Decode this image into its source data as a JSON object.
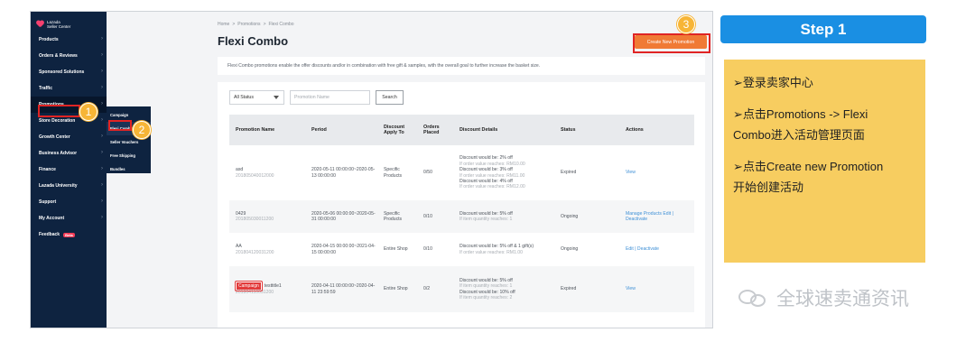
{
  "sidebar": {
    "logo": {
      "line1": "Lazada",
      "line2": "Seller Center"
    },
    "items": [
      {
        "label": "Products",
        "has_chevron": true
      },
      {
        "label": "Orders & Reviews",
        "has_chevron": true
      },
      {
        "label": "Sponsored Solutions",
        "has_chevron": true
      },
      {
        "label": "Traffic",
        "has_chevron": true
      },
      {
        "label": "Promotions",
        "has_chevron": true
      },
      {
        "label": "Store Decoration",
        "has_chevron": true
      },
      {
        "label": "Growth Center",
        "has_chevron": true
      },
      {
        "label": "Business Advisor",
        "has_chevron": true
      },
      {
        "label": "Finance",
        "has_chevron": true
      },
      {
        "label": "Lazada University",
        "has_chevron": true
      },
      {
        "label": "Support",
        "has_chevron": true
      },
      {
        "label": "My Account",
        "has_chevron": true
      },
      {
        "label": "Feedback",
        "badge": "Beta"
      }
    ],
    "submenu": [
      {
        "label": "Campaign"
      },
      {
        "label": "Flexi Combo"
      },
      {
        "label": "Seller Vouchers"
      },
      {
        "label": "Free Shipping"
      },
      {
        "label": "Bundles"
      }
    ]
  },
  "main": {
    "breadcrumb": [
      "Home",
      "Promotions",
      "Flexi Combo"
    ],
    "title": "Flexi Combo",
    "create_button": "Create New Promotion",
    "intro": "Flexi Combo promotions enable the offer discounts and/or in combination with free gift & samples, with the overall goal to further increase the basket size.",
    "filter": {
      "status_value": "All Status",
      "search_placeholder": "Promotion Name",
      "search_button": "Search"
    },
    "columns": [
      "Promotion Name",
      "Period",
      "Discount Apply To",
      "Orders Placed",
      "Discount Details",
      "Status",
      "Actions"
    ],
    "rows": [
      {
        "name": "asd",
        "id": "201805040012000",
        "period": "2020-05-11 00:00:00~2020-05-13 00:00:00",
        "apply_to": "Specific Products",
        "orders": "0/50",
        "details": [
          {
            "main": "Discount would be: 2% off",
            "sub": "If order value reaches: RM10.00"
          },
          {
            "main": "Discount would be: 3% off",
            "sub": "If order value reaches: RM11.00"
          },
          {
            "main": "Discount would be: 4% off",
            "sub": "If order value reaches: RM12.00"
          }
        ],
        "status": "Expired",
        "actions": "View",
        "campaign": ""
      },
      {
        "name": "0429",
        "id": "201805030011200",
        "period": "2020-05-06 00:00:00~2020-05-31 00:00:00",
        "apply_to": "Specific Products",
        "orders": "0/10",
        "details": [
          {
            "main": "Discount would be: 5% off",
            "sub": "If item quantity reaches: 1"
          }
        ],
        "status": "Ongoing",
        "actions": "Manage Products Edit | Deactivate",
        "campaign": ""
      },
      {
        "name": "AA",
        "id": "201804120031200",
        "period": "2020-04-15 00:00:00~2021-04-15 00:00:00",
        "apply_to": "Entire Shop",
        "orders": "0/10",
        "details": [
          {
            "main": "Discount would be: 5% off & 1 gift(s)",
            "sub": "If order value reaches: RM1.00"
          }
        ],
        "status": "Ongoing",
        "actions": "Edit | Deactivate",
        "campaign": ""
      },
      {
        "name": "testtitle1",
        "id": "201804110031200",
        "period": "2020-04-11 00:00:00~2020-04-11 23:59:59",
        "apply_to": "Entire Shop",
        "orders": "0/2",
        "details": [
          {
            "main": "Discount would be: 5% off",
            "sub": "If item quantity reaches: 1"
          },
          {
            "main": "Discount would be: 10% off",
            "sub": "If item quantity reaches: 2"
          }
        ],
        "status": "Expired",
        "actions": "View",
        "campaign": "Campaign"
      }
    ]
  },
  "markers": [
    "1",
    "2",
    "3"
  ],
  "step_panel": {
    "header": "Step 1",
    "lines": [
      "➢登录卖家中心",
      "➢点击Promotions -> Flexi",
      "Combo进入活动管理页面",
      "➢点击Create new Promotion",
      "开始创建活动"
    ]
  },
  "watermark": "全球速卖通资讯",
  "colors": {
    "sidebar_bg": "#0e2340",
    "accent_orange": "#f07a35",
    "highlight_red": "#e02424",
    "marker_yellow": "#f7b536",
    "step_blue": "#1a8fe3",
    "step_box": "#f7cd60",
    "link_blue": "#3d8fd6"
  }
}
